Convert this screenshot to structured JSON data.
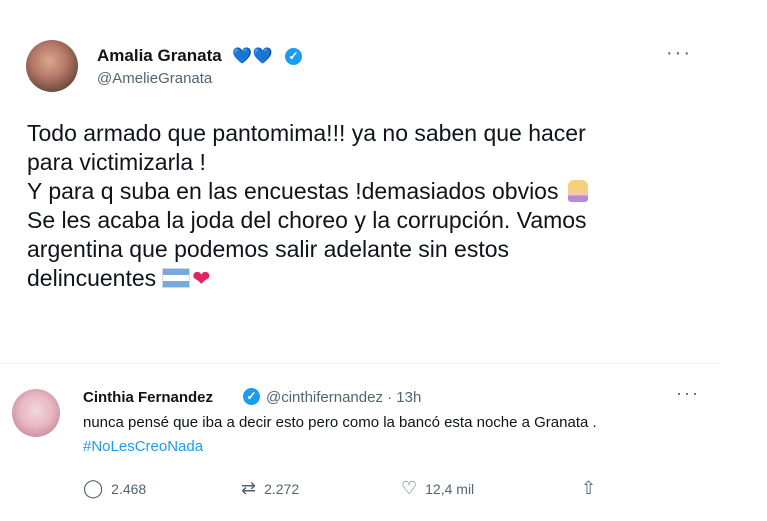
{
  "tweet1": {
    "name": "Amalia Granata",
    "hearts": "💙💙",
    "handle": "@AmelieGranata",
    "lines": [
      "Todo armado que pantomima!!! ya no saben que hacer",
      "para victimizarla !",
      "Y para q suba en las encuestas !demasiados obvios",
      "Se les acaba la joda del choreo y la corrupción. Vamos",
      "argentina que podemos salir adelante sin estos",
      "delincuentes"
    ],
    "more": "···",
    "heart_emoji": "❤"
  },
  "tweet2": {
    "name": "Cinthia Fernandez",
    "handle_time": "@cinthifernandez · 13h",
    "text": "nunca pensé que iba a decir esto pero como la bancó esta noche a Granata .",
    "hashtag": "#NoLesCreoNada",
    "more": "···",
    "actions": {
      "replies": "2.468",
      "retweets": "2.272",
      "likes": "12,4 mil"
    }
  },
  "icons": {
    "verified": "✓",
    "reply": "◯",
    "retweet": "⇄",
    "like": "♡",
    "share": "⇧"
  }
}
